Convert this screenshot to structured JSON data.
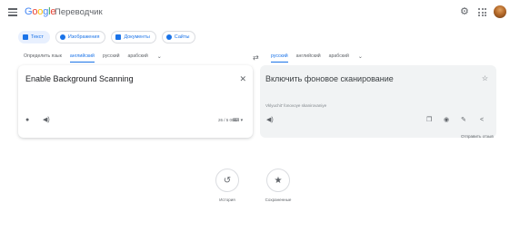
{
  "header": {
    "logo_letters": [
      {
        "ch": "G",
        "color": "#4285f4"
      },
      {
        "ch": "o",
        "color": "#ea4335"
      },
      {
        "ch": "o",
        "color": "#fbbc05"
      },
      {
        "ch": "g",
        "color": "#4285f4"
      },
      {
        "ch": "l",
        "color": "#34a853"
      },
      {
        "ch": "e",
        "color": "#ea4335"
      }
    ],
    "product_name": "Переводчик",
    "icons": [
      "menu-icon",
      "settings-icon",
      "apps-icon",
      "avatar"
    ]
  },
  "modes": [
    {
      "label": "Текст",
      "icon": "text-icon",
      "active": true
    },
    {
      "label": "Изображения",
      "icon": "image-icon",
      "active": false
    },
    {
      "label": "Документы",
      "icon": "document-icon",
      "active": false
    },
    {
      "label": "Сайты",
      "icon": "website-icon",
      "active": false
    }
  ],
  "source_langs": {
    "items": [
      "Определить язык",
      "английский",
      "русский",
      "арабский"
    ],
    "selected_index": 1,
    "more_icon": "chevron-down-icon"
  },
  "target_langs": {
    "items": [
      "русский",
      "английский",
      "арабский"
    ],
    "selected_index": 0,
    "more_icon": "chevron-down-icon"
  },
  "source": {
    "text": "Enable Background Scanning",
    "char_count": "26 / 5 000",
    "icons": [
      "close-icon",
      "microphone-icon",
      "volume-icon",
      "keyboard-icon"
    ]
  },
  "target": {
    "text": "Включить фоновое сканирование",
    "transliteration": "Vklyuchit' fonovoye skanirovaniye",
    "icons": [
      "star-icon",
      "volume-icon",
      "copy-icon",
      "rate-icon",
      "edit-icon",
      "share-icon"
    ]
  },
  "feedback_label": "Отправить отзыв",
  "bottom": [
    {
      "label": "История",
      "icon": "history-icon"
    },
    {
      "label": "Сохраненные",
      "icon": "star-icon"
    }
  ],
  "colors": {
    "accent": "#1a73e8",
    "panel_bg": "#f1f3f4",
    "icon": "#5f6368"
  }
}
